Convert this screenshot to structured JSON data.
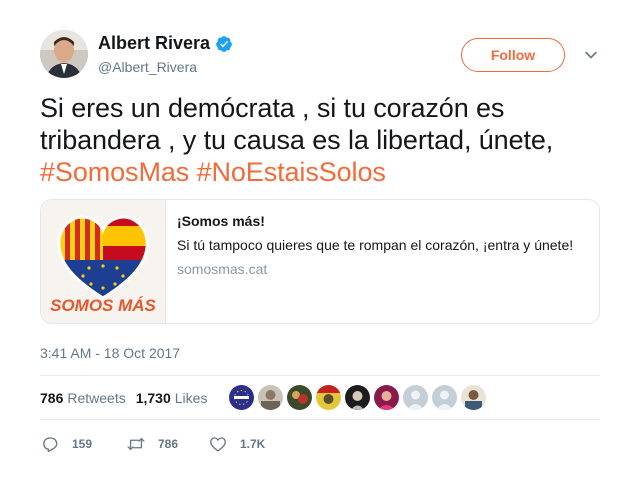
{
  "author": {
    "name": "Albert Rivera",
    "handle": "@Albert_Rivera",
    "verified": true
  },
  "follow_label": "Follow",
  "tweet": {
    "text": "Si eres un demócrata , si tu corazón es tribandera , y tu causa es la libertad, únete,",
    "hashtags": [
      "#SomosMas",
      "#NoEstaisSolos"
    ]
  },
  "card": {
    "logo_text": "SOMOS MÁS",
    "title": "¡Somos más!",
    "description": "Si tú tampoco quieres que te rompan el corazón, ¡entra y únete!",
    "domain": "somosmas.cat"
  },
  "timestamp": "3:41 AM - 18 Oct 2017",
  "stats": {
    "retweets_count": "786",
    "retweets_label": "Retweets",
    "likes_count": "1,730",
    "likes_label": "Likes"
  },
  "actions": {
    "replies": "159",
    "retweets": "786",
    "likes": "1.7K"
  },
  "colors": {
    "accent": "#f26b3a",
    "verified": "#1da1f2",
    "secondary_text": "#657786"
  },
  "icons": {
    "verified": "verified-badge-icon",
    "more": "chevron-down-icon",
    "reply": "reply-icon",
    "retweet": "retweet-icon",
    "like": "heart-icon"
  }
}
